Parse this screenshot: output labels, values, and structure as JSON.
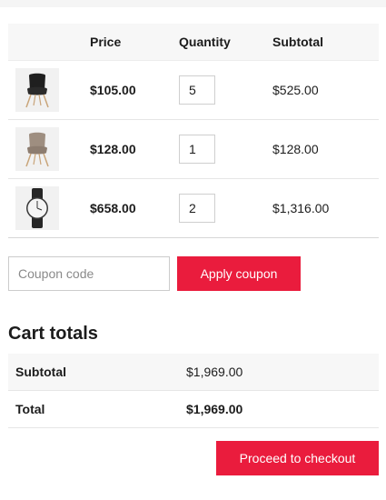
{
  "cart": {
    "headers": {
      "product": "",
      "price": "Price",
      "quantity": "Quantity",
      "subtotal": "Subtotal"
    },
    "items": [
      {
        "thumb": "black-chair-icon",
        "price": "$105.00",
        "quantity": "5",
        "subtotal": "$525.00"
      },
      {
        "thumb": "taupe-chair-icon",
        "price": "$128.00",
        "quantity": "1",
        "subtotal": "$128.00"
      },
      {
        "thumb": "wristwatch-icon",
        "price": "$658.00",
        "quantity": "2",
        "subtotal": "$1,316.00"
      }
    ]
  },
  "coupon": {
    "placeholder": "Coupon code",
    "apply_label": "Apply coupon"
  },
  "totals": {
    "title": "Cart totals",
    "subtotal_label": "Subtotal",
    "subtotal_value": "$1,969.00",
    "total_label": "Total",
    "total_value": "$1,969.00"
  },
  "checkout_label": "Proceed to checkout",
  "colors": {
    "accent": "#ea1c3d",
    "header_bg": "#f7f7f7"
  }
}
